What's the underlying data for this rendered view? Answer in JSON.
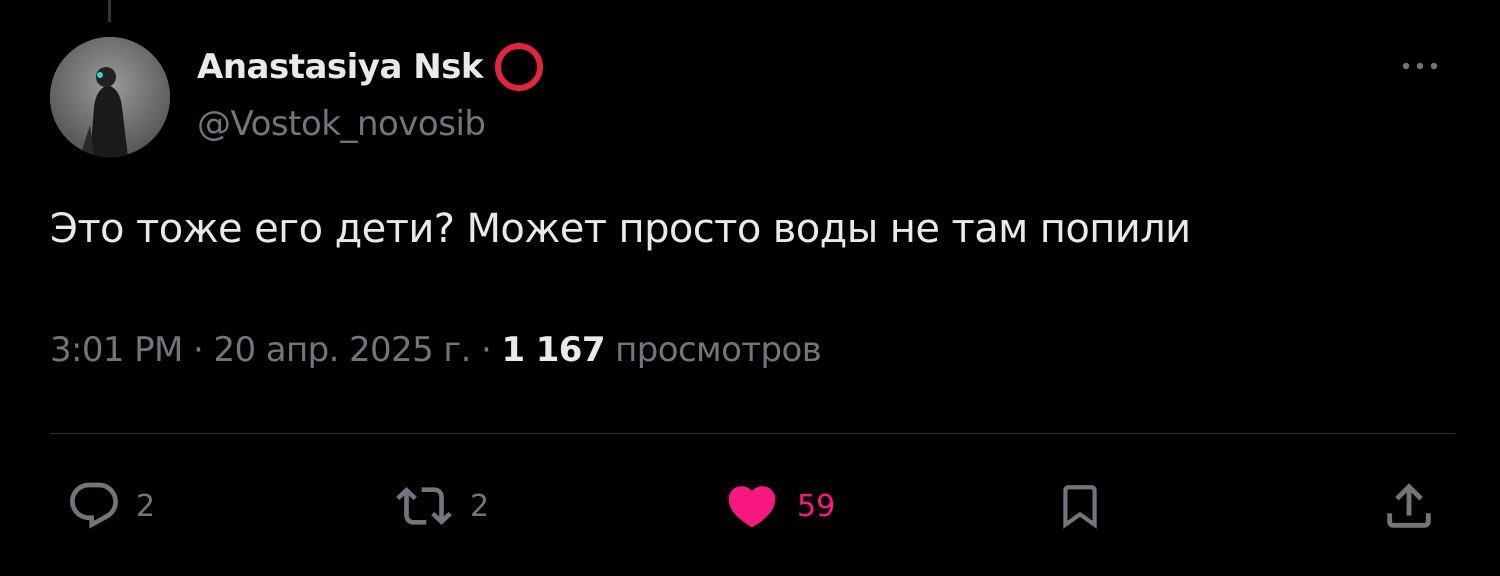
{
  "author": {
    "display_name": "Anastasiya Nsk",
    "handle": "@Vostok_novosib",
    "badge_icon": "red-ring-icon"
  },
  "tweet": {
    "text": "Это тоже его дети? Может просто воды не там попили"
  },
  "meta": {
    "time": "3:01 PM",
    "separator": "·",
    "date": "20 апр. 2025 г.",
    "views_count": "1 167",
    "views_label": "просмотров"
  },
  "actions": {
    "reply_count": "2",
    "retweet_count": "2",
    "like_count": "59",
    "liked": true
  },
  "colors": {
    "background": "#000000",
    "text_primary": "#e7e9ea",
    "text_secondary": "#71767b",
    "divider": "#2f3336",
    "like_pink": "#f91880",
    "badge_red": "#e0263d"
  }
}
